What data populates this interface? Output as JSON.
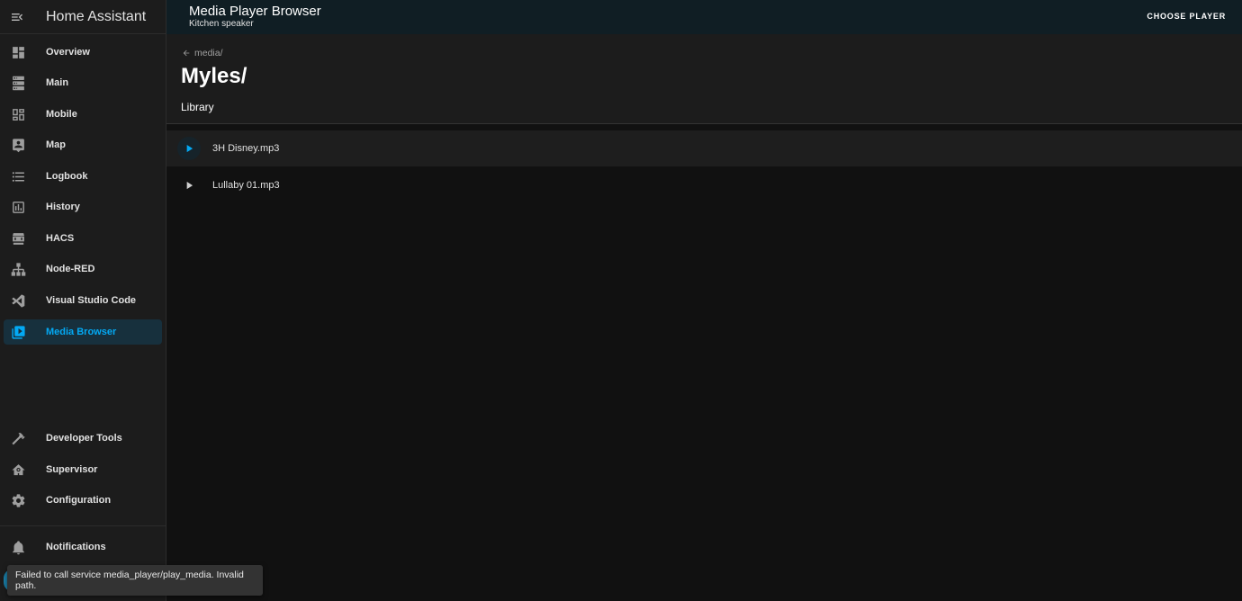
{
  "app": {
    "title": "Home Assistant"
  },
  "sidebar": {
    "items": [
      {
        "label": "Overview",
        "icon": "dashboard-icon"
      },
      {
        "label": "Main",
        "icon": "server-icon"
      },
      {
        "label": "Mobile",
        "icon": "grid-icon"
      },
      {
        "label": "Map",
        "icon": "map-icon"
      },
      {
        "label": "Logbook",
        "icon": "list-icon"
      },
      {
        "label": "History",
        "icon": "chart-icon"
      },
      {
        "label": "HACS",
        "icon": "hacs-icon"
      },
      {
        "label": "Node-RED",
        "icon": "sitemap-icon"
      },
      {
        "label": "Visual Studio Code",
        "icon": "vscode-icon"
      },
      {
        "label": "Media Browser",
        "icon": "play-box-icon",
        "active": true
      }
    ],
    "bottom_items": [
      {
        "label": "Developer Tools",
        "icon": "hammer-icon"
      },
      {
        "label": "Supervisor",
        "icon": "home-gear-icon"
      },
      {
        "label": "Configuration",
        "icon": "gear-icon"
      }
    ],
    "notifications": {
      "label": "Notifications",
      "icon": "bell-icon"
    }
  },
  "topbar": {
    "title": "Media Player Browser",
    "subtitle": "Kitchen speaker",
    "choose_player": "CHOOSE PLAYER"
  },
  "browser": {
    "back_label": "media/",
    "folder_title": "Myles/",
    "folder_subtitle": "Library",
    "items": [
      {
        "name": "3H Disney.mp3",
        "highlighted": true
      },
      {
        "name": "Lullaby 01.mp3",
        "highlighted": false
      }
    ]
  },
  "toast": {
    "message": "Failed to call service media_player/play_media. Invalid path."
  },
  "colors": {
    "accent": "#03a9f4",
    "sidebar_bg": "#1c1c1c",
    "topbar_bg": "#101e24",
    "content_bg": "#111111"
  }
}
